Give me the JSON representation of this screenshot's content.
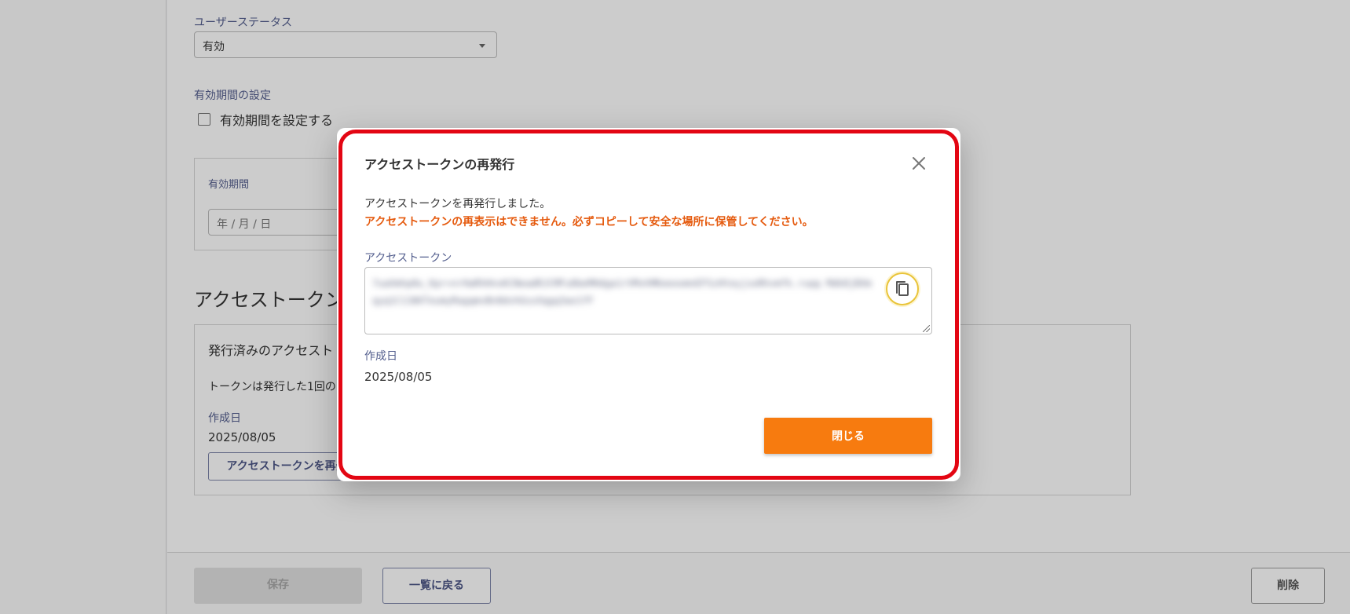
{
  "background": {
    "user_status_label": "ユーザーステータス",
    "user_status_value": "有効",
    "expiry_setting_label": "有効期間の設定",
    "expiry_checkbox_label": "有効期間を設定する",
    "expiry_period_label": "有効期間",
    "date_placeholder": "年 / 月 / 日",
    "token_section_title": "アクセストークン",
    "issued_token_heading": "発行済みのアクセスト",
    "token_note": "トークンは発行した1回の",
    "created_label": "作成日",
    "created_value": "2025/08/05",
    "reissue_button": "アクセストークンを再発"
  },
  "footer": {
    "save_label": "保存",
    "back_label": "一覧に戻る",
    "delete_label": "削除"
  },
  "modal": {
    "title": "アクセストークンの再発行",
    "message": "アクセストークンを再発行しました。",
    "warning": "アクセストークンの再表示はできません。必ずコピーして安全な場所に保管してください。",
    "token_label": "アクセストークン",
    "token_value": "7uaXmhp8u_Kpr+nrHaRhHnxKCNeadRJCMFu8beMHdga1rVMvhMKeeoomnEFSzHteyjsoRhvmfk.ruqq Mdk8jBXmqyq1C11NXTeumyRagqmvBn8dvhGsxXqgq3ao1fF",
    "created_label": "作成日",
    "created_value": "2025/08/05",
    "close_button": "閉じる",
    "colors": {
      "primary": "#f77b0f",
      "warning": "#e55a0e",
      "highlight": "#e30613"
    },
    "icons": {
      "close": "close-icon",
      "copy": "copy-icon"
    }
  }
}
